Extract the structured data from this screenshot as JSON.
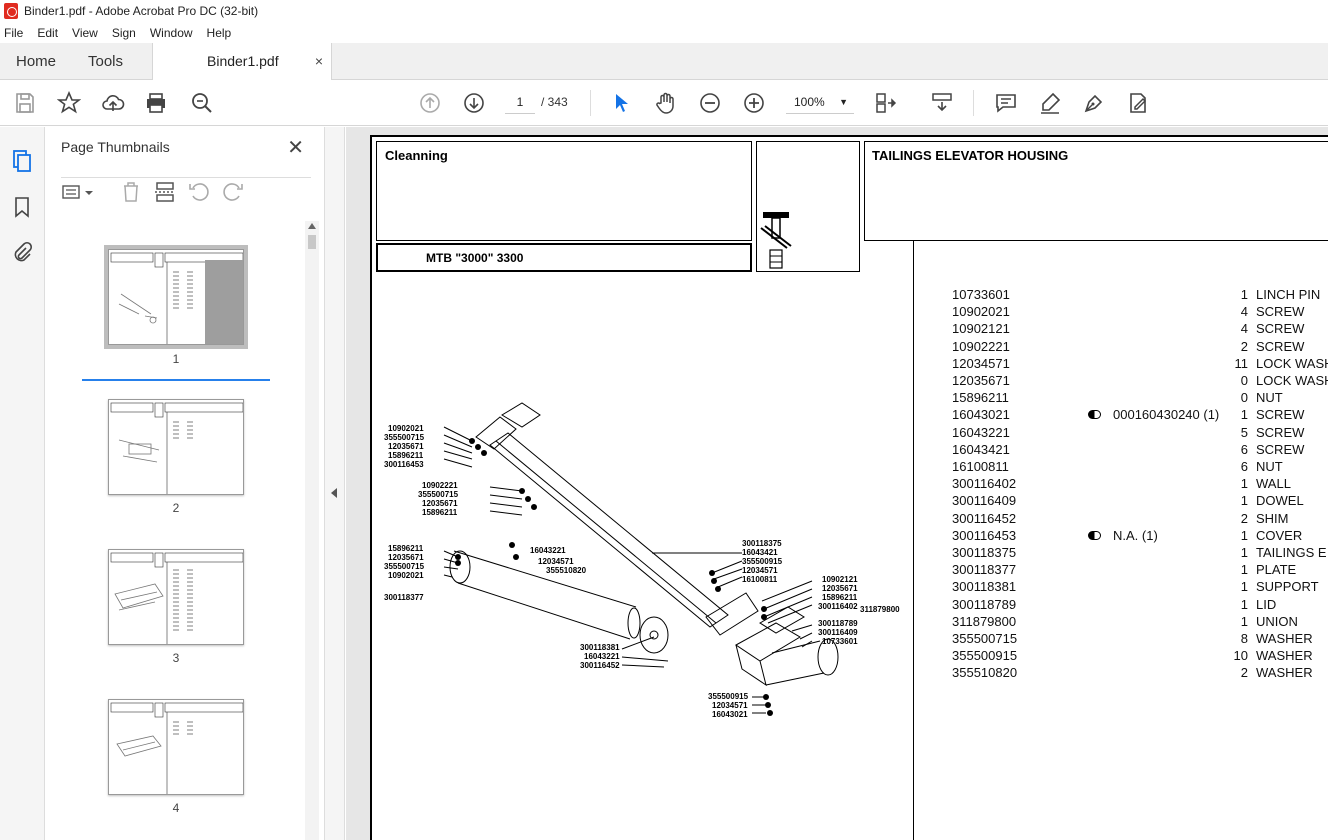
{
  "window": {
    "title": "Binder1.pdf - Adobe Acrobat Pro DC (32-bit)"
  },
  "menu": {
    "items": [
      "File",
      "Edit",
      "View",
      "Sign",
      "Window",
      "Help"
    ]
  },
  "tabs": {
    "home": "Home",
    "tools": "Tools",
    "document": "Binder1.pdf",
    "close": "×"
  },
  "toolbar": {
    "current_page": "1",
    "total_pages": "/ 343",
    "zoom": "100%"
  },
  "thumbnails": {
    "title": "Page Thumbnails",
    "close": "✕",
    "pages": [
      {
        "num": "1",
        "selected": true
      },
      {
        "num": "2",
        "selected": false
      },
      {
        "num": "3",
        "selected": false
      },
      {
        "num": "4",
        "selected": false
      }
    ]
  },
  "document": {
    "section": "Cleanning",
    "model": "MTB \"3000\" 3300",
    "group_title": "TAILINGS ELEVATOR HOUSING",
    "parts": [
      {
        "pn": "10733601",
        "ref": "",
        "qty": "1",
        "desc": "LINCH PIN"
      },
      {
        "pn": "10902021",
        "ref": "",
        "qty": "4",
        "desc": "SCREW"
      },
      {
        "pn": "10902121",
        "ref": "",
        "qty": "4",
        "desc": "SCREW"
      },
      {
        "pn": "10902221",
        "ref": "",
        "qty": "2",
        "desc": "SCREW"
      },
      {
        "pn": "12034571",
        "ref": "",
        "qty": "11",
        "desc": "LOCK WASHE"
      },
      {
        "pn": "12035671",
        "ref": "",
        "qty": "0",
        "desc": "LOCK WASHE"
      },
      {
        "pn": "15896211",
        "ref": "",
        "qty": "0",
        "desc": "NUT"
      },
      {
        "pn": "16043021",
        "ref": "000160430240  (1)",
        "qty": "1",
        "desc": "SCREW"
      },
      {
        "pn": "16043221",
        "ref": "",
        "qty": "5",
        "desc": "SCREW"
      },
      {
        "pn": "16043421",
        "ref": "",
        "qty": "6",
        "desc": "SCREW"
      },
      {
        "pn": "16100811",
        "ref": "",
        "qty": "6",
        "desc": "NUT"
      },
      {
        "pn": "300116402",
        "ref": "",
        "qty": "1",
        "desc": "WALL"
      },
      {
        "pn": "300116409",
        "ref": "",
        "qty": "1",
        "desc": "DOWEL"
      },
      {
        "pn": "300116452",
        "ref": "",
        "qty": "2",
        "desc": "SHIM"
      },
      {
        "pn": "300116453",
        "ref": "N.A.  (1)",
        "qty": "1",
        "desc": "COVER"
      },
      {
        "pn": "300118375",
        "ref": "",
        "qty": "1",
        "desc": "TAILINGS E"
      },
      {
        "pn": "300118377",
        "ref": "",
        "qty": "1",
        "desc": "PLATE"
      },
      {
        "pn": "300118381",
        "ref": "",
        "qty": "1",
        "desc": "SUPPORT"
      },
      {
        "pn": "300118789",
        "ref": "",
        "qty": "1",
        "desc": "LID"
      },
      {
        "pn": "311879800",
        "ref": "",
        "qty": "1",
        "desc": "UNION"
      },
      {
        "pn": "355500715",
        "ref": "",
        "qty": "8",
        "desc": "WASHER"
      },
      {
        "pn": "355500915",
        "ref": "",
        "qty": "10",
        "desc": "WASHER"
      },
      {
        "pn": "355510820",
        "ref": "",
        "qty": "2",
        "desc": "WASHER"
      }
    ],
    "callouts": [
      {
        "text": "10902021"
      },
      {
        "text": "355500715"
      },
      {
        "text": "12035671"
      },
      {
        "text": "15896211"
      },
      {
        "text": "300116453"
      },
      {
        "text": "10902221"
      },
      {
        "text": "355500715"
      },
      {
        "text": "12035671"
      },
      {
        "text": "15896211"
      },
      {
        "text": "15896211"
      },
      {
        "text": "12035671"
      },
      {
        "text": "355500715"
      },
      {
        "text": "10902021"
      },
      {
        "text": "300118377"
      },
      {
        "text": "16043221"
      },
      {
        "text": "12034571"
      },
      {
        "text": "355510820"
      },
      {
        "text": "300118375"
      },
      {
        "text": "16043421"
      },
      {
        "text": "355500915"
      },
      {
        "text": "12034571"
      },
      {
        "text": "16100811"
      },
      {
        "text": "10902121"
      },
      {
        "text": "12035671"
      },
      {
        "text": "15896211"
      },
      {
        "text": "300116402"
      },
      {
        "text": "311879800"
      },
      {
        "text": "300118789"
      },
      {
        "text": "300116409"
      },
      {
        "text": "10733601"
      },
      {
        "text": "300118381"
      },
      {
        "text": "16043221"
      },
      {
        "text": "300116452"
      },
      {
        "text": "355500915"
      },
      {
        "text": "12034571"
      },
      {
        "text": "16043021"
      }
    ]
  }
}
